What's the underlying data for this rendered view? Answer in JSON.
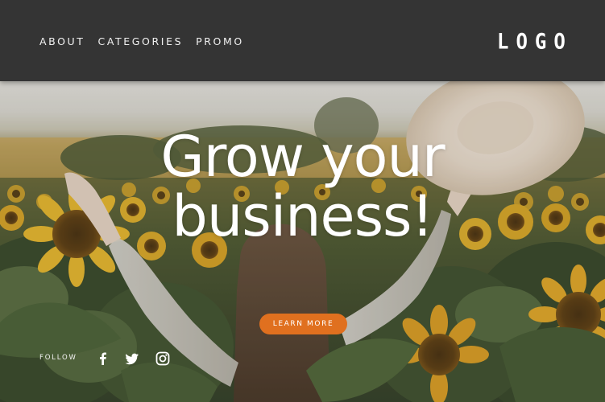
{
  "nav": {
    "links": [
      "ABOUT",
      "CATEGORIES",
      "PROMO"
    ],
    "logo": "LOGO"
  },
  "hero": {
    "headline_line1": "Grow your",
    "headline_line2": "business!",
    "cta_label": "LEARN MORE",
    "follow_label": "FOLLOW",
    "social_icons": [
      "facebook-icon",
      "twitter-icon",
      "instagram-icon"
    ]
  },
  "colors": {
    "nav_bg": "#343434",
    "accent": "#e0701f",
    "text": "#ffffff"
  }
}
